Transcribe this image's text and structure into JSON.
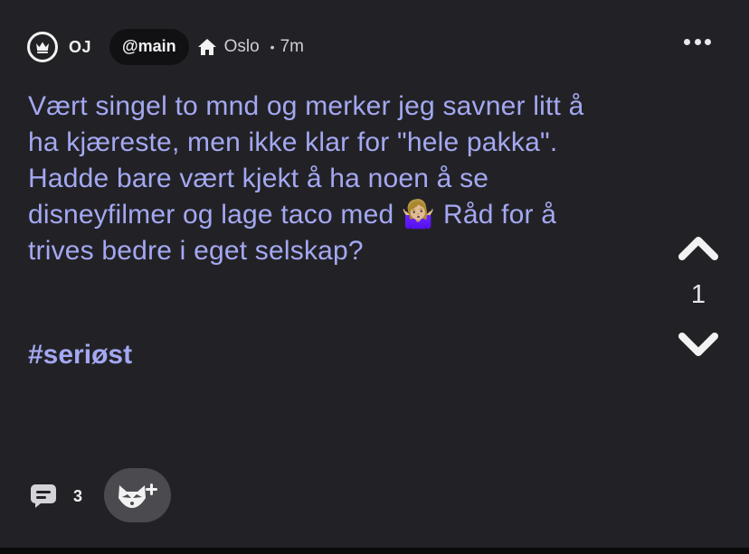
{
  "post": {
    "author": "OJ",
    "channel": "@main",
    "location": "Oslo",
    "separator": "•",
    "time": "7m",
    "body": "Vært singel to mnd og merker jeg savner litt å ha kjæreste, men ikke klar for \"hele pakka\". Hadde bare vært kjekt å ha noen å se disneyfilmer og lage taco med 🤷🏼‍♀️ Råd for å trives bedre i eget selskap?",
    "hashtag": "#seriøst",
    "votes": "1",
    "comments": "3"
  },
  "icons": {
    "avatar": "crown-icon",
    "location": "home-icon",
    "more": "more-dots-icon",
    "upvote": "chevron-up-icon",
    "downvote": "chevron-down-icon",
    "comment": "comment-bubble-icon",
    "react": "fox-plus-icon"
  },
  "colors": {
    "background": "#222226",
    "text_accent": "#a4a8f2",
    "pill_background": "#111113",
    "react_button": "#4a4a4f"
  }
}
